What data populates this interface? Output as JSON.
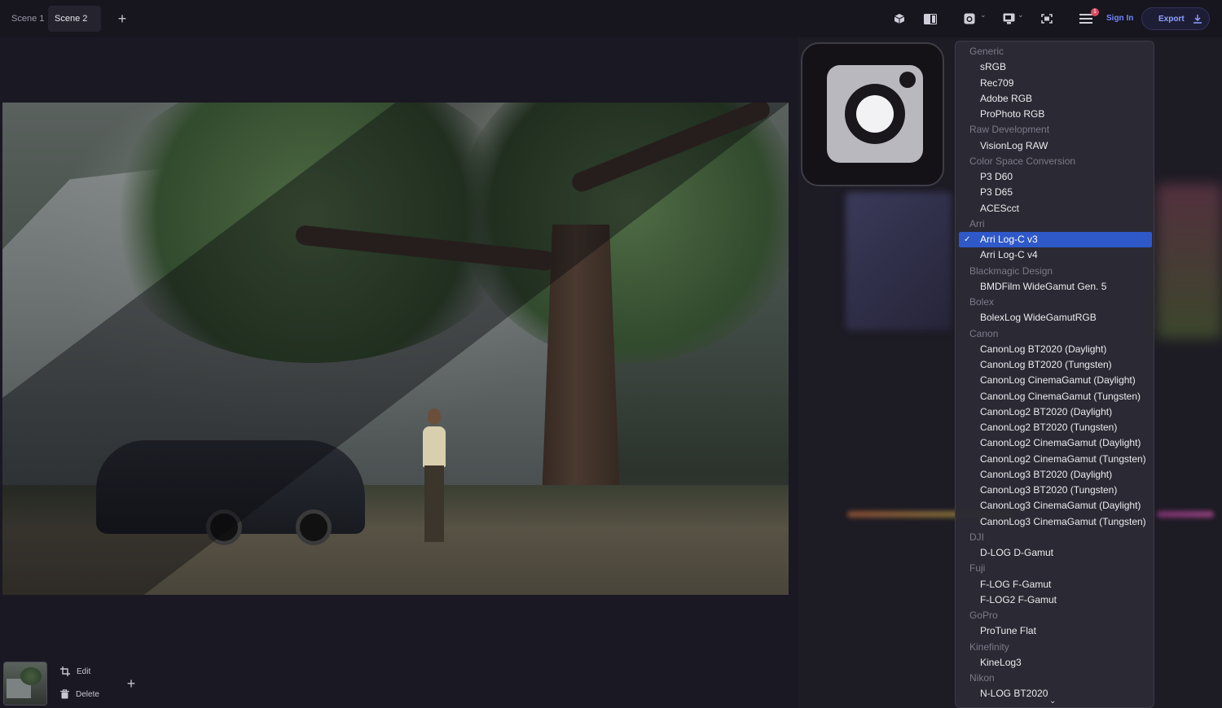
{
  "tabs": [
    {
      "label": "Scene 1",
      "active": false
    },
    {
      "label": "Scene 2",
      "active": true
    }
  ],
  "toolbar": {
    "notification_count": "1",
    "sign_in_label": "Sign In",
    "export_label": "Export"
  },
  "scene_actions": {
    "edit_label": "Edit",
    "delete_label": "Delete"
  },
  "dropdown": {
    "selected": "Arri Log-C v3",
    "rows": [
      {
        "type": "header",
        "label": "Generic"
      },
      {
        "type": "item",
        "label": "sRGB"
      },
      {
        "type": "item",
        "label": "Rec709"
      },
      {
        "type": "item",
        "label": "Adobe RGB"
      },
      {
        "type": "item",
        "label": "ProPhoto RGB"
      },
      {
        "type": "header",
        "label": "Raw Development"
      },
      {
        "type": "item",
        "label": "VisionLog RAW"
      },
      {
        "type": "header",
        "label": "Color Space Conversion"
      },
      {
        "type": "item",
        "label": "P3 D60"
      },
      {
        "type": "item",
        "label": "P3 D65"
      },
      {
        "type": "item",
        "label": "ACEScct"
      },
      {
        "type": "header",
        "label": "Arri"
      },
      {
        "type": "item",
        "label": "Arri Log-C v3",
        "selected": true
      },
      {
        "type": "item",
        "label": "Arri Log-C v4"
      },
      {
        "type": "header",
        "label": "Blackmagic Design"
      },
      {
        "type": "item",
        "label": "BMDFilm WideGamut Gen. 5"
      },
      {
        "type": "header",
        "label": "Bolex"
      },
      {
        "type": "item",
        "label": "BolexLog WideGamutRGB"
      },
      {
        "type": "header",
        "label": "Canon"
      },
      {
        "type": "item",
        "label": "CanonLog BT2020 (Daylight)"
      },
      {
        "type": "item",
        "label": "CanonLog BT2020 (Tungsten)"
      },
      {
        "type": "item",
        "label": "CanonLog CinemaGamut (Daylight)"
      },
      {
        "type": "item",
        "label": "CanonLog CinemaGamut (Tungsten)"
      },
      {
        "type": "item",
        "label": "CanonLog2 BT2020 (Daylight)"
      },
      {
        "type": "item",
        "label": "CanonLog2 BT2020 (Tungsten)"
      },
      {
        "type": "item",
        "label": "CanonLog2 CinemaGamut (Daylight)"
      },
      {
        "type": "item",
        "label": "CanonLog2 CinemaGamut (Tungsten)"
      },
      {
        "type": "item",
        "label": "CanonLog3 BT2020 (Daylight)"
      },
      {
        "type": "item",
        "label": "CanonLog3 BT2020 (Tungsten)"
      },
      {
        "type": "item",
        "label": "CanonLog3 CinemaGamut (Daylight)"
      },
      {
        "type": "item",
        "label": "CanonLog3 CinemaGamut (Tungsten)"
      },
      {
        "type": "header",
        "label": "DJI"
      },
      {
        "type": "item",
        "label": "D-LOG D-Gamut"
      },
      {
        "type": "header",
        "label": "Fuji"
      },
      {
        "type": "item",
        "label": "F-LOG F-Gamut"
      },
      {
        "type": "item",
        "label": "F-LOG2 F-Gamut"
      },
      {
        "type": "header",
        "label": "GoPro"
      },
      {
        "type": "item",
        "label": "ProTune Flat"
      },
      {
        "type": "header",
        "label": "Kinefinity"
      },
      {
        "type": "item",
        "label": "KineLog3"
      },
      {
        "type": "header",
        "label": "Nikon"
      },
      {
        "type": "item",
        "label": "N-LOG BT2020"
      }
    ]
  },
  "colors": {
    "accent": "#2f58c8",
    "link": "#6f86ff",
    "badge": "#d94a60"
  }
}
